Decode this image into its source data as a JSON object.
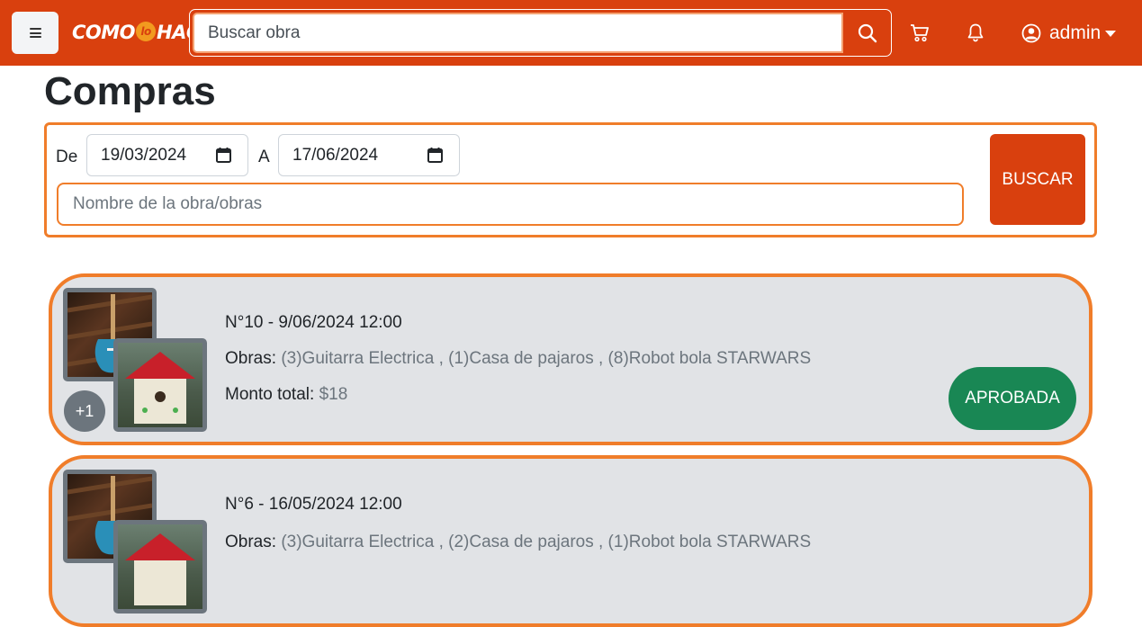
{
  "navbar": {
    "logo_text_left": "COMO",
    "logo_text_mid": "lo",
    "logo_text_right": "HAGO",
    "search_placeholder": "Buscar obra",
    "user_label": "admin",
    "brand_color": "#d9400e"
  },
  "page": {
    "title": "Compras"
  },
  "filter": {
    "from_label": "De",
    "from_date": "19/03/2024",
    "to_label": "A",
    "to_date": "17/06/2024",
    "name_placeholder": "Nombre de la obra/obras",
    "search_button": "BUSCAR"
  },
  "orders": [
    {
      "title": "N°10 - 9/06/2024 12:00",
      "items_label": "Obras:",
      "items": "(3)Guitarra Electrica , (1)Casa de pajaros , (8)Robot bola STARWARS",
      "total_label": "Monto total:",
      "total": "$18",
      "more_count": "+1",
      "status": "APROBADA",
      "status_color": "#198754"
    },
    {
      "title": "N°6 - 16/05/2024 12:00",
      "items_label": "Obras:",
      "items": "(3)Guitarra Electrica , (2)Casa de pajaros , (1)Robot bola STARWARS",
      "total_label": "Monto total:",
      "total": "",
      "more_count": "",
      "status": "",
      "status_color": "#198754"
    }
  ]
}
